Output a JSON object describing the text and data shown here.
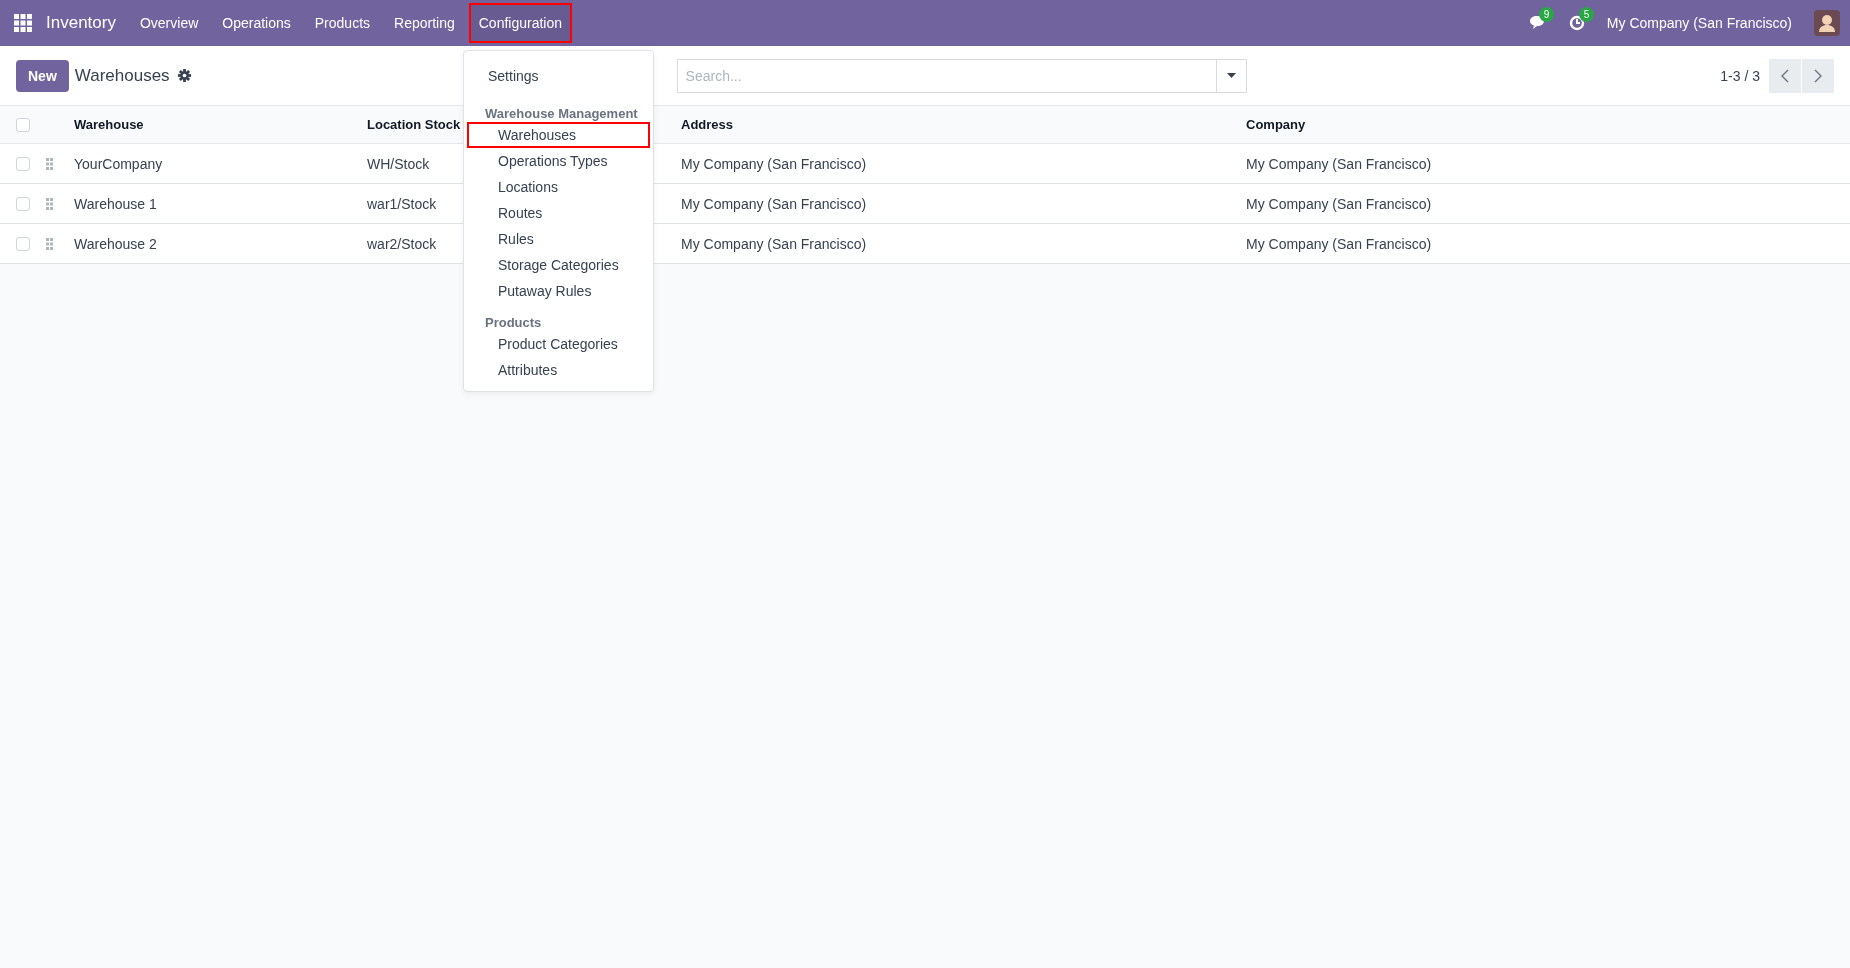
{
  "navbar": {
    "app_name": "Inventory",
    "menu": [
      {
        "label": "Overview",
        "highlighted": false
      },
      {
        "label": "Operations",
        "highlighted": false
      },
      {
        "label": "Products",
        "highlighted": false
      },
      {
        "label": "Reporting",
        "highlighted": false
      },
      {
        "label": "Configuration",
        "highlighted": true
      }
    ],
    "messages_count": "9",
    "activities_count": "5",
    "company": "My Company (San Francisco)"
  },
  "dropdown": [
    {
      "kind": "item",
      "label": "Settings",
      "highlighted": false
    },
    {
      "kind": "header",
      "label": "Warehouse Management"
    },
    {
      "kind": "subitem",
      "label": "Warehouses",
      "highlighted": true
    },
    {
      "kind": "subitem",
      "label": "Operations Types",
      "highlighted": false
    },
    {
      "kind": "subitem",
      "label": "Locations",
      "highlighted": false
    },
    {
      "kind": "subitem",
      "label": "Routes",
      "highlighted": false
    },
    {
      "kind": "subitem",
      "label": "Rules",
      "highlighted": false
    },
    {
      "kind": "subitem",
      "label": "Storage Categories",
      "highlighted": false
    },
    {
      "kind": "subitem",
      "label": "Putaway Rules",
      "highlighted": false
    },
    {
      "kind": "header",
      "label": "Products"
    },
    {
      "kind": "subitem",
      "label": "Product Categories",
      "highlighted": false
    },
    {
      "kind": "subitem",
      "label": "Attributes",
      "highlighted": false
    }
  ],
  "control_panel": {
    "new_button": "New",
    "breadcrumb": "Warehouses",
    "search": {
      "placeholder": "Search..."
    },
    "pager": "1-3 / 3"
  },
  "table": {
    "select_all_checked": false,
    "columns": [
      "Warehouse",
      "Location Stock",
      "Address",
      "Company"
    ],
    "rows": [
      {
        "checked": false,
        "cells": [
          "YourCompany",
          "WH/Stock",
          "My Company (San Francisco)",
          "My Company (San Francisco)"
        ]
      },
      {
        "checked": false,
        "cells": [
          "Warehouse 1",
          "war1/Stock",
          "My Company (San Francisco)",
          "My Company (San Francisco)"
        ]
      },
      {
        "checked": false,
        "cells": [
          "Warehouse 2",
          "war2/Stock",
          "My Company (San Francisco)",
          "My Company (San Francisco)"
        ]
      }
    ]
  }
}
